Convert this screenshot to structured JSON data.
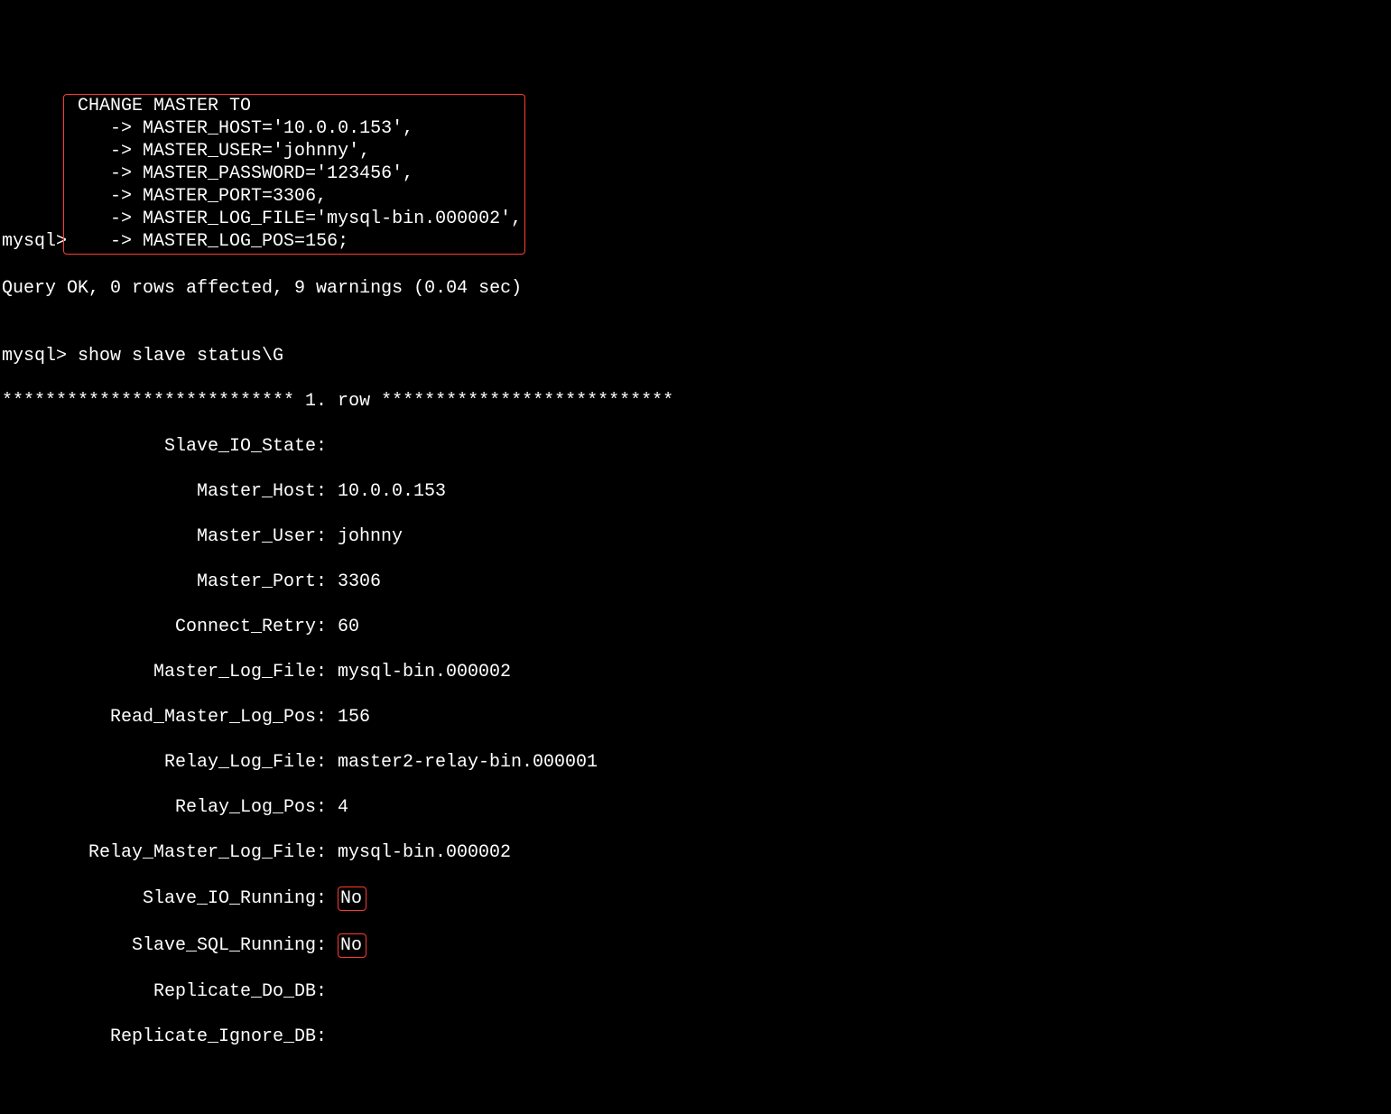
{
  "prompt1": "mysql>",
  "cont": "    ->",
  "cmd1": {
    "l0": " CHANGE MASTER TO",
    "l1": " MASTER_HOST='10.0.0.153',",
    "l2": " MASTER_USER='johnny',",
    "l3": " MASTER_PASSWORD='123456',",
    "l4": " MASTER_PORT=3306,",
    "l5": " MASTER_LOG_FILE='mysql-bin.000002',",
    "l6": " MASTER_LOG_POS=156;"
  },
  "result1": "Query OK, 0 rows affected, 9 warnings (0.04 sec)",
  "blank": "",
  "cmd2": " show slave status\\G",
  "rowheader": "*************************** 1. row ***************************",
  "status": {
    "Slave_IO_State": {
      "label": "Slave_IO_State:",
      "value": ""
    },
    "Master_Host": {
      "label": "Master_Host:",
      "value": " 10.0.0.153"
    },
    "Master_User": {
      "label": "Master_User:",
      "value": " johnny"
    },
    "Master_Port": {
      "label": "Master_Port:",
      "value": " 3306"
    },
    "Connect_Retry": {
      "label": "Connect_Retry:",
      "value": " 60"
    },
    "Master_Log_File": {
      "label": "Master_Log_File:",
      "value": " mysql-bin.000002"
    },
    "Read_Master_Log_Pos": {
      "label": "Read_Master_Log_Pos:",
      "value": " 156"
    },
    "Relay_Log_File": {
      "label": "Relay_Log_File:",
      "value": " master2-relay-bin.000001"
    },
    "Relay_Log_Pos": {
      "label": "Relay_Log_Pos:",
      "value": " 4"
    },
    "Relay_Master_Log_File": {
      "label": "Relay_Master_Log_File:",
      "value": " mysql-bin.000002"
    },
    "Slave_IO_Running": {
      "label": "Slave_IO_Running:",
      "value": "No"
    },
    "Slave_SQL_Running": {
      "label": "Slave_SQL_Running:",
      "value": "No"
    },
    "Replicate_Do_DB": {
      "label": "Replicate_Do_DB:",
      "value": ""
    },
    "Replicate_Ignore_DB": {
      "label": "Replicate_Ignore_DB:",
      "value": ""
    }
  }
}
